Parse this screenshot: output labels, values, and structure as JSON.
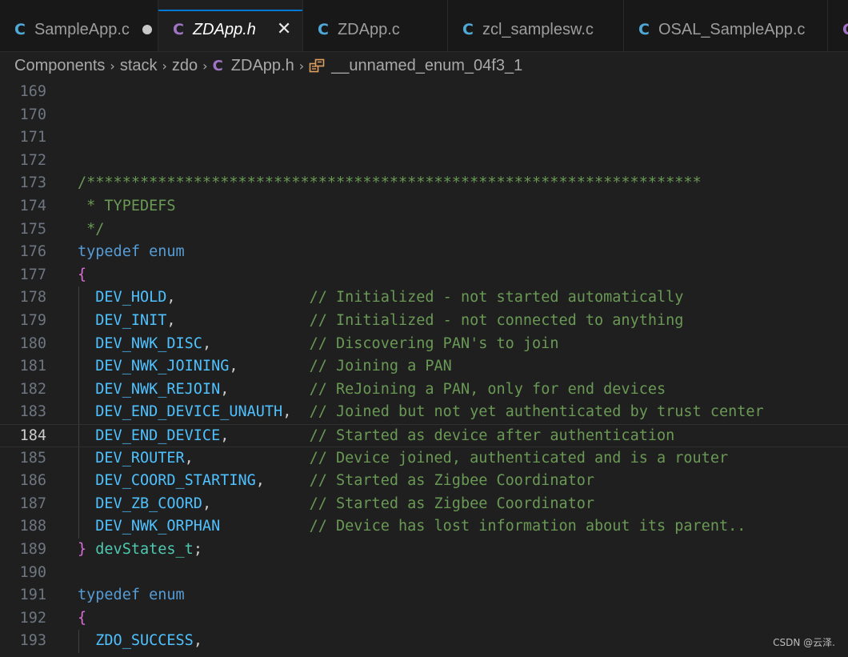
{
  "tabs": [
    {
      "icon": "C",
      "label": "SampleApp.c",
      "state": "modified"
    },
    {
      "icon": "C",
      "label": "ZDApp.h",
      "state": "active",
      "close": "✕"
    },
    {
      "icon": "C",
      "label": "ZDApp.c",
      "state": ""
    },
    {
      "icon": "C",
      "label": "zcl_samplesw.c",
      "state": ""
    },
    {
      "icon": "C",
      "label": "OSAL_SampleApp.c",
      "state": ""
    },
    {
      "icon": "C",
      "label": "",
      "state": ""
    }
  ],
  "colors": {
    "c_icon_blue": "#4fa8d6",
    "c_icon_purple": "#a074c4",
    "enum_icon": "#e0a060"
  },
  "breadcrumb": {
    "items": [
      "Components",
      "stack",
      "zdo",
      "ZDApp.h",
      "__unnamed_enum_04f3_1"
    ],
    "file_icon": "C"
  },
  "current_line": "184",
  "lines": [
    {
      "n": "169",
      "code": ""
    },
    {
      "n": "170",
      "code": ""
    },
    {
      "n": "171",
      "code": ""
    },
    {
      "n": "172",
      "code": ""
    },
    {
      "n": "173",
      "code": "/*********************************************************************"
    },
    {
      "n": "174",
      "code": " * TYPEDEFS"
    },
    {
      "n": "175",
      "code": " */"
    },
    {
      "n": "176",
      "code": "typedef enum"
    },
    {
      "n": "177",
      "code": "{"
    },
    {
      "n": "178",
      "code": "  DEV_HOLD,               // Initialized - not started automatically"
    },
    {
      "n": "179",
      "code": "  DEV_INIT,               // Initialized - not connected to anything"
    },
    {
      "n": "180",
      "code": "  DEV_NWK_DISC,           // Discovering PAN's to join"
    },
    {
      "n": "181",
      "code": "  DEV_NWK_JOINING,        // Joining a PAN"
    },
    {
      "n": "182",
      "code": "  DEV_NWK_REJOIN,         // ReJoining a PAN, only for end devices"
    },
    {
      "n": "183",
      "code": "  DEV_END_DEVICE_UNAUTH,  // Joined but not yet authenticated by trust center"
    },
    {
      "n": "184",
      "code": "  DEV_END_DEVICE,         // Started as device after authentication"
    },
    {
      "n": "185",
      "code": "  DEV_ROUTER,             // Device joined, authenticated and is a router"
    },
    {
      "n": "186",
      "code": "  DEV_COORD_STARTING,     // Started as Zigbee Coordinator"
    },
    {
      "n": "187",
      "code": "  DEV_ZB_COORD,           // Started as Zigbee Coordinator"
    },
    {
      "n": "188",
      "code": "  DEV_NWK_ORPHAN          // Device has lost information about its parent.."
    },
    {
      "n": "189",
      "code": "} devStates_t;"
    },
    {
      "n": "190",
      "code": ""
    },
    {
      "n": "191",
      "code": "typedef enum"
    },
    {
      "n": "192",
      "code": "{"
    },
    {
      "n": "193",
      "code": "  ZDO_SUCCESS,"
    }
  ],
  "watermark": "CSDN @云泽."
}
